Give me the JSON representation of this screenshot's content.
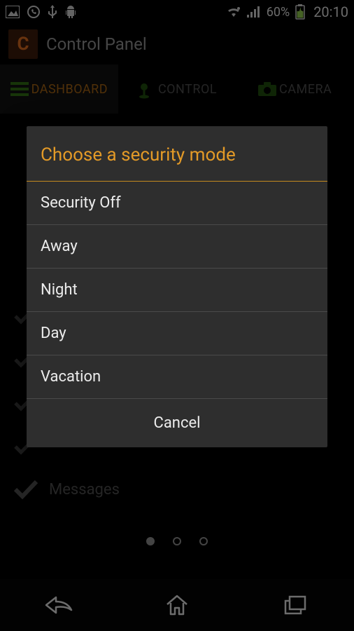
{
  "status": {
    "battery_pct": "60%",
    "time": "20:10"
  },
  "app": {
    "title": "Control Panel",
    "logo_letter": "C"
  },
  "tabs": [
    {
      "label": "DASHBOARD"
    },
    {
      "label": "CONTROL"
    },
    {
      "label": "CAMERA"
    }
  ],
  "bg": {
    "messages_label": "Messages"
  },
  "dialog": {
    "title": "Choose a security mode",
    "options": [
      "Security Off",
      "Away",
      "Night",
      "Day",
      "Vacation"
    ],
    "cancel": "Cancel"
  },
  "colors": {
    "accent": "#e39a27",
    "bg": "#000000",
    "dialog_bg": "#2e2e2e"
  }
}
